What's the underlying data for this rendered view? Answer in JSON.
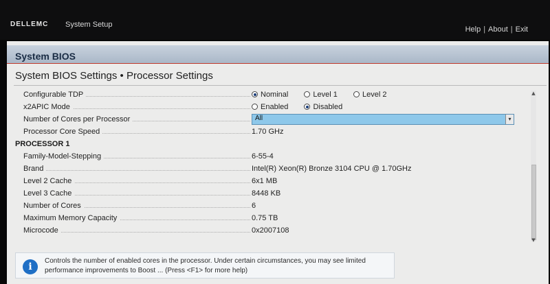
{
  "header": {
    "logo_text": "DELLEMC",
    "app_title": "System Setup",
    "links": [
      "Help",
      "About",
      "Exit"
    ]
  },
  "section": {
    "title": "System BIOS"
  },
  "page": {
    "title": "System BIOS Settings • Processor Settings"
  },
  "settings": {
    "configurable_tdp": {
      "label": "Configurable TDP",
      "options": [
        "Nominal",
        "Level 1",
        "Level 2"
      ],
      "selected": "Nominal"
    },
    "x2apic": {
      "label": "x2APIC Mode",
      "options": [
        "Enabled",
        "Disabled"
      ],
      "selected": "Disabled"
    },
    "cores_per_processor": {
      "label": "Number of Cores per Processor",
      "value": "All"
    },
    "core_speed": {
      "label": "Processor Core Speed",
      "value": "1.70 GHz"
    }
  },
  "processor1": {
    "heading": "PROCESSOR 1",
    "rows": [
      {
        "label": "Family-Model-Stepping",
        "value": "6-55-4"
      },
      {
        "label": "Brand",
        "value": "Intel(R) Xeon(R) Bronze 3104 CPU @ 1.70GHz"
      },
      {
        "label": "Level 2 Cache",
        "value": "6x1 MB"
      },
      {
        "label": "Level 3 Cache",
        "value": "8448 KB"
      },
      {
        "label": "Number of Cores",
        "value": "6"
      },
      {
        "label": "Maximum Memory Capacity",
        "value": "0.75 TB"
      },
      {
        "label": "Microcode",
        "value": "0x2007108"
      }
    ]
  },
  "help": {
    "text": "Controls the number of enabled cores in the processor. Under certain circumstances, you may see limited performance improvements to Boost ... (Press <F1> for more help)"
  },
  "colors": {
    "topbar": "#0e0e0f",
    "section_bar": "#aab8c8",
    "highlight": "#8ec8ea",
    "info_icon": "#1f6fc5"
  }
}
